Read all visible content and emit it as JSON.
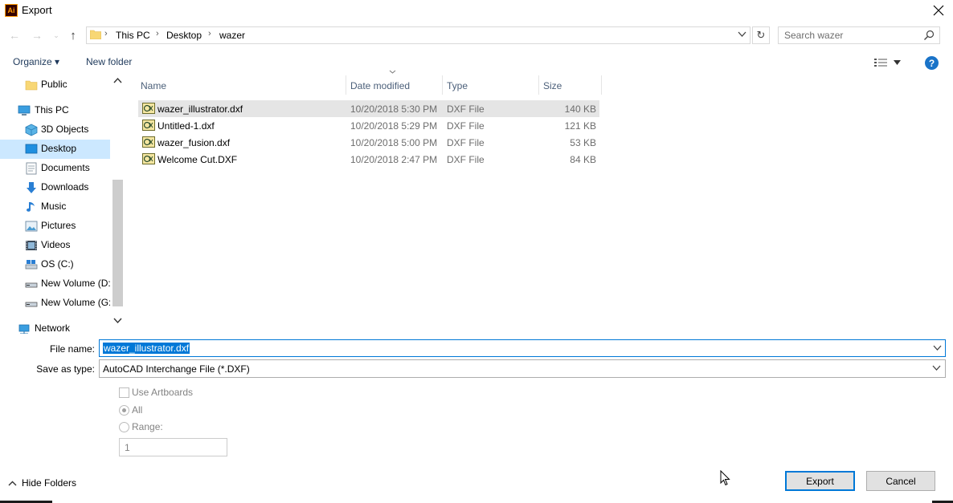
{
  "window": {
    "title": "Export",
    "app_icon_text": "Ai",
    "close_glyph": "✕"
  },
  "nav": {
    "back_glyph": "←",
    "forward_glyph": "→",
    "recent_glyph": "⌄",
    "up_glyph": "↑",
    "breadcrumbs": [
      "This PC",
      "Desktop",
      "wazer"
    ],
    "refresh_glyph": "↻",
    "search_placeholder": "Search wazer"
  },
  "toolbar": {
    "organize": "Organize ▾",
    "new_folder": "New folder",
    "help": "?"
  },
  "sidebar": {
    "items": [
      {
        "label": "Public",
        "icon": "folder-icon"
      },
      {
        "label": "This PC",
        "icon": "computer-icon"
      },
      {
        "label": "3D Objects",
        "icon": "cube-icon"
      },
      {
        "label": "Desktop",
        "icon": "desktop-icon",
        "selected": true
      },
      {
        "label": "Documents",
        "icon": "document-icon"
      },
      {
        "label": "Downloads",
        "icon": "download-icon"
      },
      {
        "label": "Music",
        "icon": "music-icon"
      },
      {
        "label": "Pictures",
        "icon": "picture-icon"
      },
      {
        "label": "Videos",
        "icon": "video-icon"
      },
      {
        "label": "OS (C:)",
        "icon": "drive-icon"
      },
      {
        "label": "New Volume (D:",
        "icon": "drive-icon"
      },
      {
        "label": "New Volume (G:",
        "icon": "drive-icon"
      },
      {
        "label": "Network",
        "icon": "network-icon"
      }
    ]
  },
  "file_list": {
    "columns": [
      "Name",
      "Date modified",
      "Type",
      "Size"
    ],
    "rows": [
      {
        "name": "wazer_illustrator.dxf",
        "date": "10/20/2018 5:30 PM",
        "type": "DXF File",
        "size": "140 KB",
        "selected": true
      },
      {
        "name": "Untitled-1.dxf",
        "date": "10/20/2018 5:29 PM",
        "type": "DXF File",
        "size": "121 KB"
      },
      {
        "name": "wazer_fusion.dxf",
        "date": "10/20/2018 5:00 PM",
        "type": "DXF File",
        "size": "53 KB"
      },
      {
        "name": "Welcome Cut.DXF",
        "date": "10/20/2018 2:47 PM",
        "type": "DXF File",
        "size": "84 KB"
      }
    ]
  },
  "form": {
    "file_name_label": "File name:",
    "file_name_value": "wazer_illustrator.dxf",
    "save_type_label": "Save as type:",
    "save_type_value": "AutoCAD Interchange File (*.DXF)",
    "use_artboards_label": "Use Artboards",
    "all_label": "All",
    "range_label": "Range:",
    "range_value": "1"
  },
  "footer": {
    "hide_folders": "Hide Folders",
    "export": "Export",
    "cancel": "Cancel"
  },
  "colors": {
    "accent": "#0078d7",
    "selection": "#cce8ff",
    "row_selected": "#e5e5e5"
  }
}
